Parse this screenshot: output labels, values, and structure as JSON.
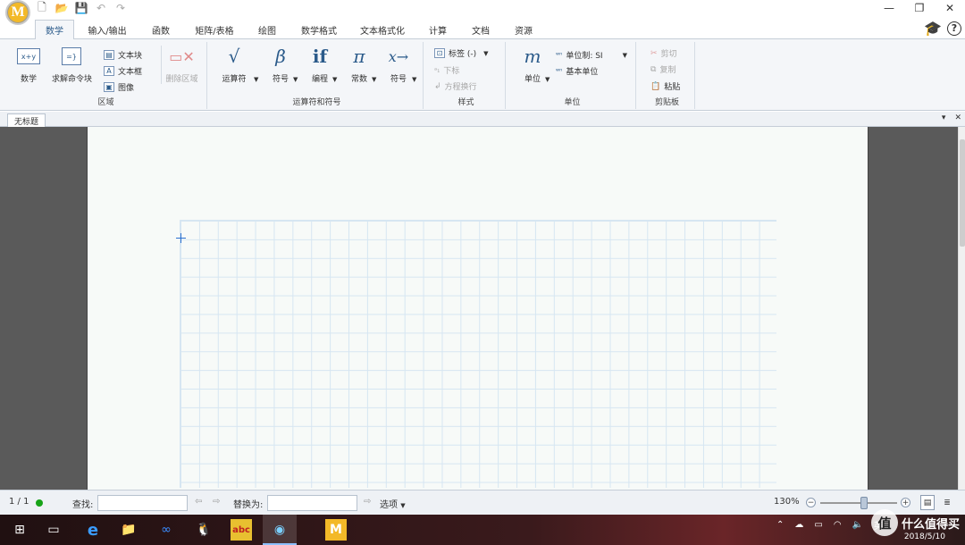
{
  "app": {
    "logo_letter": "M"
  },
  "qat": {
    "icons": [
      "new-doc-icon",
      "open-folder-icon",
      "save-icon",
      "undo-icon",
      "redo-icon"
    ]
  },
  "window": {
    "minimize": "—",
    "restore": "❐",
    "close": "✕"
  },
  "tabs": [
    {
      "label": "数学",
      "active": true
    },
    {
      "label": "输入/输出"
    },
    {
      "label": "函数"
    },
    {
      "label": "矩阵/表格"
    },
    {
      "label": "绘图"
    },
    {
      "label": "数学格式"
    },
    {
      "label": "文本格式化"
    },
    {
      "label": "计算"
    },
    {
      "label": "文档"
    },
    {
      "label": "资源"
    }
  ],
  "help": {
    "cap": "🎓",
    "q": "?"
  },
  "ribbon": {
    "region": {
      "label": "区域",
      "math": {
        "label": "数学",
        "icon_text": "x+y"
      },
      "solve_block": {
        "label": "求解命令块",
        "icon_text": "=}"
      },
      "text_block": "文本块",
      "text_box": "文本框",
      "image": "图像",
      "delete_region": "删除区域"
    },
    "operators": {
      "label": "运算符和符号",
      "operator": {
        "label": "运算符",
        "sym": "√"
      },
      "symbol": {
        "label": "符号",
        "sym": "β"
      },
      "programming": {
        "label": "编程",
        "sym": "if"
      },
      "constant": {
        "label": "常数",
        "sym": "π"
      },
      "symbol2": {
        "label": "符号",
        "sym": "x→"
      }
    },
    "style": {
      "label": "样式",
      "tag": "标签 (-)",
      "subscript": "下标",
      "equation_wrap": "方程换行"
    },
    "units": {
      "label": "单位",
      "unit": {
        "label": "单位",
        "sym": "m"
      },
      "unit_system": "单位制: SI",
      "base_units": "基本单位"
    },
    "clipboard": {
      "label": "剪贴板",
      "cut": "剪切",
      "copy": "复制",
      "paste": "粘贴"
    }
  },
  "doc_tab": {
    "title": "无标题"
  },
  "status": {
    "page": "1 / 1",
    "find_label": "查找:",
    "find_value": "",
    "replace_label": "替换为:",
    "replace_value": "",
    "options": "选项",
    "zoom": "130%"
  },
  "taskbar": {
    "apps": [
      "windows-start-icon",
      "task-view-icon",
      "edge-icon",
      "file-explorer-icon",
      "baidu-netdisk-icon",
      "qq-icon",
      "abc-app-icon",
      "browser-app-icon",
      "mathcad-icon"
    ],
    "tray_lang": "英",
    "date": "2018/5/10",
    "watermark": "值 什么值得买"
  },
  "colors": {
    "accent": "#2a5a8a",
    "grid": "#d6e6f2",
    "taskbar": "#3a1a1c"
  }
}
